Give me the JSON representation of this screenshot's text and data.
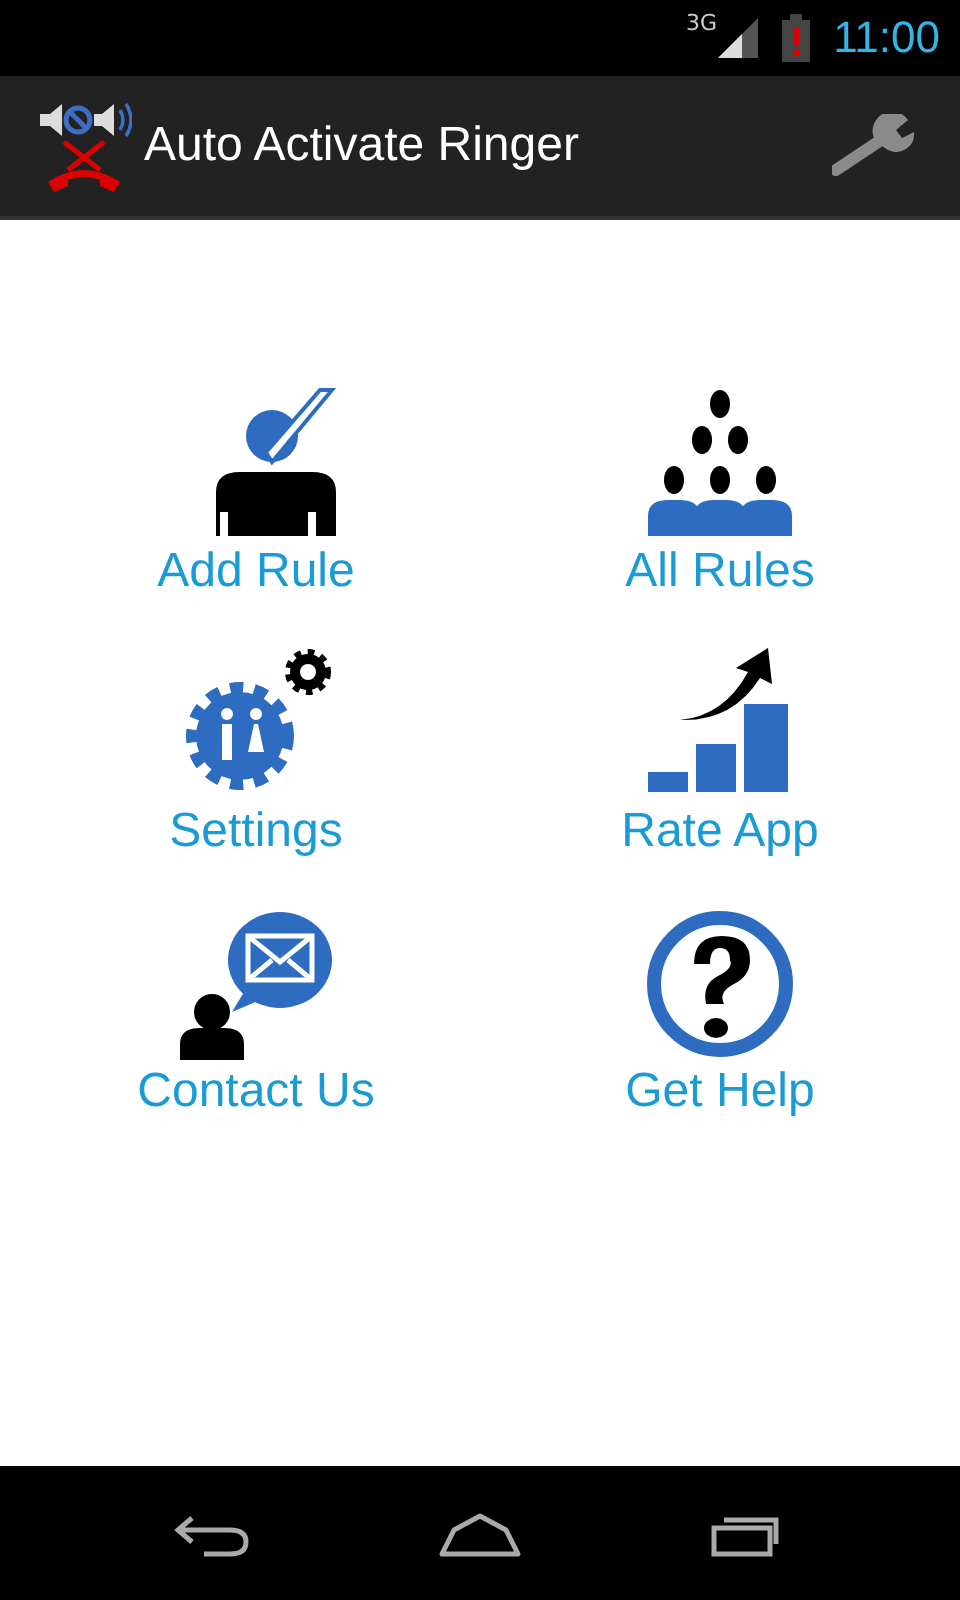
{
  "status_bar": {
    "network": "3G",
    "time": "11:00"
  },
  "action_bar": {
    "title": "Auto Activate Ringer"
  },
  "menu": [
    {
      "kind": "add_rule",
      "label": "Add Rule"
    },
    {
      "kind": "all_rules",
      "label": "All Rules"
    },
    {
      "kind": "settings",
      "label": "Settings"
    },
    {
      "kind": "rate_app",
      "label": "Rate App"
    },
    {
      "kind": "contact_us",
      "label": "Contact Us"
    },
    {
      "kind": "get_help",
      "label": "Get Help"
    }
  ]
}
